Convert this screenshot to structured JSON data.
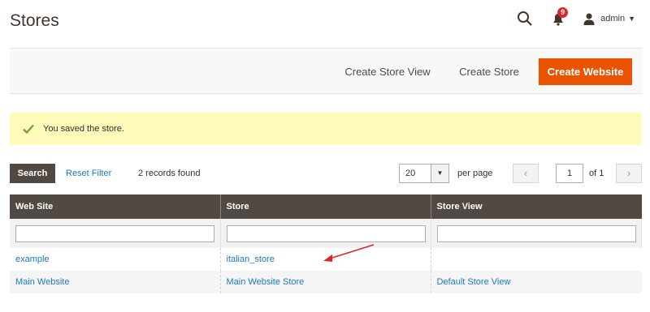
{
  "header": {
    "title": "Stores",
    "notification_count": "9",
    "user": "admin",
    "icons": {
      "search": "search-icon",
      "notifications": "bell-icon",
      "user": "user-icon",
      "caret": "caret-down-icon"
    }
  },
  "actions": {
    "create_store_view": "Create Store View",
    "create_store": "Create Store",
    "create_website": "Create Website"
  },
  "message": {
    "text": "You saved the store.",
    "icon": "check-icon"
  },
  "grid_controls": {
    "search_label": "Search",
    "reset_label": "Reset Filter",
    "records_found": "2 records found",
    "per_page_value": "20",
    "per_page_label": "per page",
    "current_page": "1",
    "of_pages": "of 1"
  },
  "table": {
    "columns": [
      "Web Site",
      "Store",
      "Store View"
    ],
    "rows": [
      {
        "website": "example",
        "store": "italian_store",
        "store_view": ""
      },
      {
        "website": "Main Website",
        "store": "Main Website Store",
        "store_view": "Default Store View"
      }
    ]
  },
  "colors": {
    "primary": "#eb5202",
    "dark": "#514943",
    "link": "#1979c3",
    "message_bg": "#fffbbb",
    "annotation": "#e02424"
  }
}
